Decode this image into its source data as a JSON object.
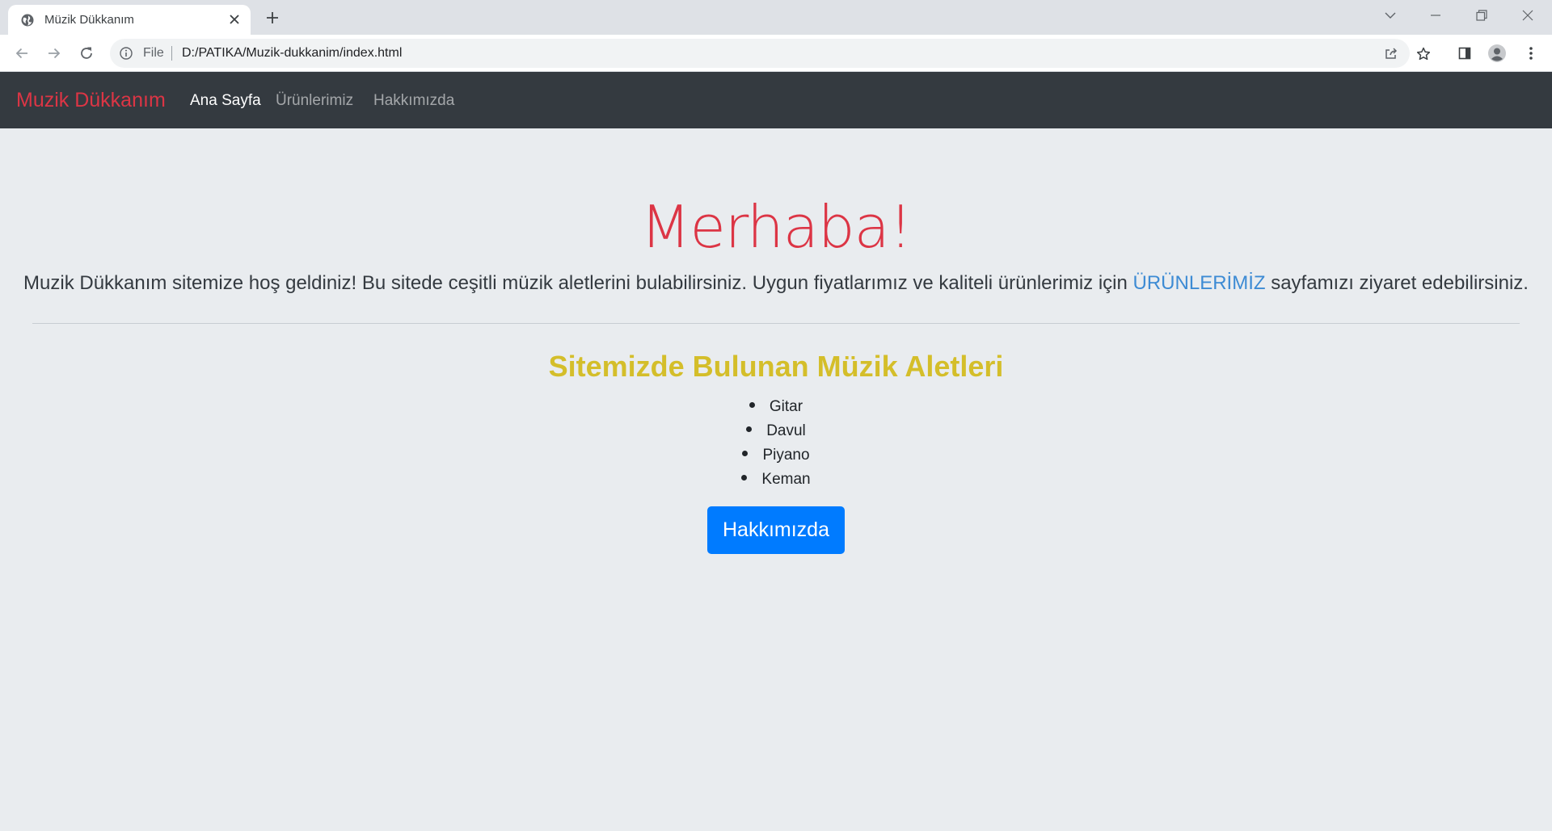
{
  "browser": {
    "tab_title": "Müzik Dükkanım",
    "omnibox_scheme": "File",
    "url": "D:/PATIKA/Muzik-dukkanim/index.html"
  },
  "site": {
    "brand": "Muzik Dükkanım",
    "nav": {
      "home": "Ana Sayfa",
      "products": "Ürünlerimiz",
      "about": "Hakkımızda"
    },
    "hero": {
      "title": "Merhaba!",
      "lead_before": "Muzik Dükkanım sitemize hoş geldiniz! Bu sitede ceşitli müzik aletlerini bulabilirsiniz. Uygun fiyatlarımız ve kaliteli ürünlerimiz için ",
      "lead_link": "ÜRÜNLERİMİZ",
      "lead_after": " sayfamızı ziyaret edebilirsiniz."
    },
    "instruments": {
      "title": "Sitemizde Bulunan Müzik Aletleri",
      "items": [
        "Gitar",
        "Davul",
        "Piyano",
        "Keman"
      ]
    },
    "cta_label": "Hakkımızda"
  },
  "colors": {
    "navbar_bg": "#343a40",
    "brand": "#dc3545",
    "page_bg": "#e9ecef",
    "section_title": "#d4be2a",
    "button": "#007bff",
    "link": "#3d8bd4"
  }
}
